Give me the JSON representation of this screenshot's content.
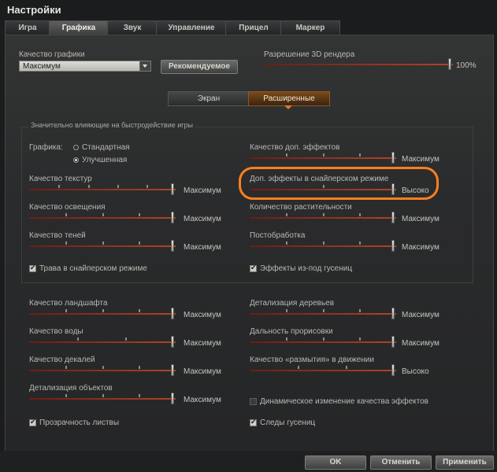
{
  "window": {
    "title": "Настройки"
  },
  "tabs": [
    "Игра",
    "Графика",
    "Звук",
    "Управление",
    "Прицел",
    "Маркер"
  ],
  "active_tab": "Графика",
  "graphics_quality": {
    "label": "Качество графики",
    "value": "Максимум",
    "recommended_button": "Рекомендуемое"
  },
  "render_resolution": {
    "label": "Разрешение 3D рендера",
    "value": "100%",
    "level": 1.0
  },
  "modes": {
    "screen": "Экран",
    "advanced": "Расширенные",
    "active": "Расширенные"
  },
  "group_title": "Значительно влияющие на быстродействие игры",
  "graphics_type": {
    "label": "Графика:",
    "options": [
      "Стандартная",
      "Улучшенная"
    ],
    "selected": "Улучшенная"
  },
  "left_group": [
    {
      "label": "Качество текстур",
      "value": "Максимум",
      "level": 1.0
    },
    {
      "label": "Качество освещения",
      "value": "Максимум",
      "level": 1.0
    },
    {
      "label": "Качество теней",
      "value": "Максимум",
      "level": 1.0
    }
  ],
  "right_group": [
    {
      "label": "Качество доп. эффектов",
      "value": "Максимум",
      "level": 1.0
    },
    {
      "label": "Доп. эффекты в снайперском режиме",
      "value": "Высоко",
      "level": 1.0
    },
    {
      "label": "Количество растительности",
      "value": "Максимум",
      "level": 1.0
    },
    {
      "label": "Постобработка",
      "value": "Максимум",
      "level": 1.0
    }
  ],
  "grass_sniper": {
    "label": "Трава в снайперском режиме",
    "checked": true
  },
  "track_effects": {
    "label": "Эффекты из-под гусениц",
    "checked": true
  },
  "left_lower": [
    {
      "label": "Качество ландшафта",
      "value": "Максимум",
      "level": 1.0
    },
    {
      "label": "Качество воды",
      "value": "Максимум",
      "level": 1.0
    },
    {
      "label": "Качество декалей",
      "value": "Максимум",
      "level": 1.0
    },
    {
      "label": "Детализация объектов",
      "value": "Максимум",
      "level": 1.0
    }
  ],
  "right_lower": [
    {
      "label": "Детализация деревьев",
      "value": "Максимум",
      "level": 1.0
    },
    {
      "label": "Дальность прорисовки",
      "value": "Максимум",
      "level": 1.0
    },
    {
      "label": "Качество «размытия» в движении",
      "value": "Высоко",
      "level": 1.0
    }
  ],
  "dynamic_effects": {
    "label": "Динамическое изменение качества эффектов",
    "checked": false
  },
  "foliage_transparency": {
    "label": "Прозрачность листвы",
    "checked": true
  },
  "track_marks": {
    "label": "Следы гусениц",
    "checked": true
  },
  "footer": {
    "ok": "OK",
    "cancel": "Отменить",
    "apply": "Применить"
  },
  "colors": {
    "accent": "#e07b2a",
    "highlight": "#ff7f1f",
    "slider": "#b04428"
  }
}
